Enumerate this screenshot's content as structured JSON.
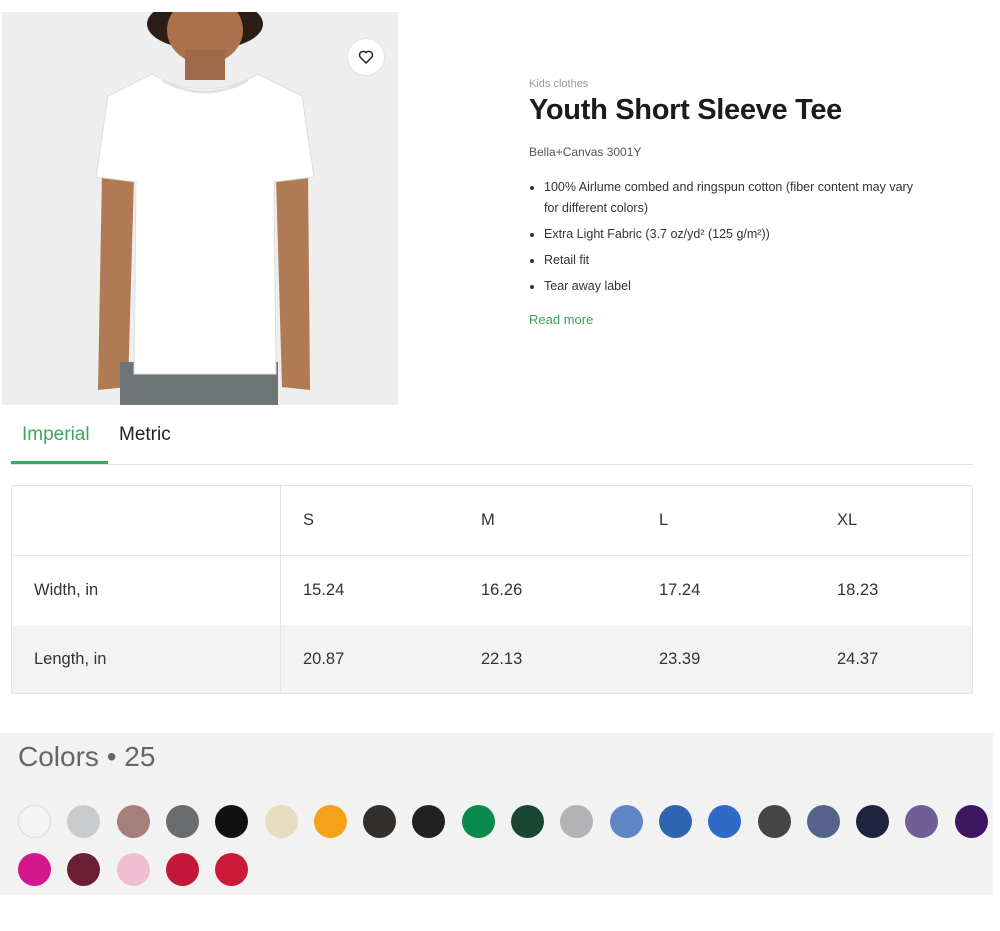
{
  "product": {
    "category": "Kids clothes",
    "title": "Youth Short Sleeve Tee",
    "model": "Bella+Canvas 3001Y",
    "features": [
      "100% Airlume combed and ringspun cotton (fiber content may vary for different colors)",
      "Extra Light Fabric (3.7 oz/yd² (125 g/m²))",
      "Retail fit",
      "Tear away label"
    ],
    "read_more": "Read more",
    "favorite_icon": "heart-icon"
  },
  "tabs": [
    {
      "label": "Imperial",
      "active": true
    },
    {
      "label": "Metric",
      "active": false
    }
  ],
  "size_table": {
    "headers": [
      "",
      "S",
      "M",
      "L",
      "XL"
    ],
    "rows": [
      {
        "label": "Width, in",
        "values": [
          "15.24",
          "16.26",
          "17.24",
          "18.23"
        ]
      },
      {
        "label": "Length, in",
        "values": [
          "20.87",
          "22.13",
          "23.39",
          "24.37"
        ]
      }
    ]
  },
  "colors": {
    "heading": "Colors • 25",
    "swatches": [
      "#f4f4f4",
      "#c9cbcc",
      "#a57f79",
      "#6b6c6e",
      "#111111",
      "#e6dcc0",
      "#f4a319",
      "#332f2c",
      "#222222",
      "#0b8a4f",
      "#1b4634",
      "#b2b2b4",
      "#5e86c3",
      "#2f64b0",
      "#2f6ac8",
      "#454545",
      "#56648d",
      "#1c2440",
      "#6f5f97",
      "#3c175f",
      "#d3178d",
      "#6b1e34",
      "#efbfd1",
      "#c4173a",
      "#cb1a37"
    ]
  },
  "accent_color": "#3aa95a"
}
